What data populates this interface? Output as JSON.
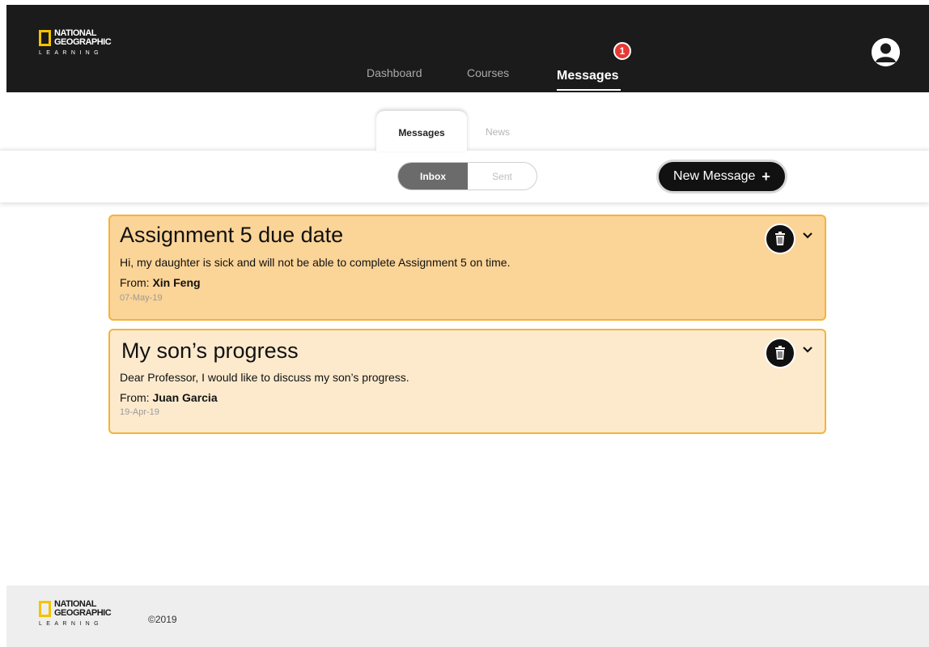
{
  "brand": {
    "logo_line1": "NATIONAL",
    "logo_line2": "GEOGRAPHIC",
    "logo_line3": "LEARNING",
    "accent_color": "#f5c200"
  },
  "nav": {
    "items": [
      {
        "label": "Dashboard"
      },
      {
        "label": "Courses"
      },
      {
        "label": "Messages",
        "active": true
      }
    ],
    "notification_count": "1",
    "avatar_icon": "user-avatar-icon"
  },
  "tabs": {
    "messages": "Messages",
    "news": "News"
  },
  "toolbar": {
    "inbox_label": "Inbox",
    "sent_label": "Sent",
    "new_message_label": "New Message",
    "new_message_icon": "+"
  },
  "messages": [
    {
      "title": "Assignment 5 due date",
      "body": "Hi, my daughter is sick and will not be able to complete Assignment 5 on time.",
      "from_label": "From:",
      "from_name": "Xin Feng",
      "date": "07-May-19",
      "unread": true
    },
    {
      "title": "My son’s progress",
      "body": "Dear Professor,  I would like to discuss my son’s progress.",
      "from_label": "From:",
      "from_name": "Juan Garcia",
      "date": "19-Apr-19",
      "unread": false
    }
  ],
  "footer": {
    "copyright": "©2019"
  },
  "colors": {
    "unread_bg": "#fbd497",
    "read_bg": "#fdeacd",
    "card_border": "#f5b335",
    "badge": "#e53935"
  }
}
